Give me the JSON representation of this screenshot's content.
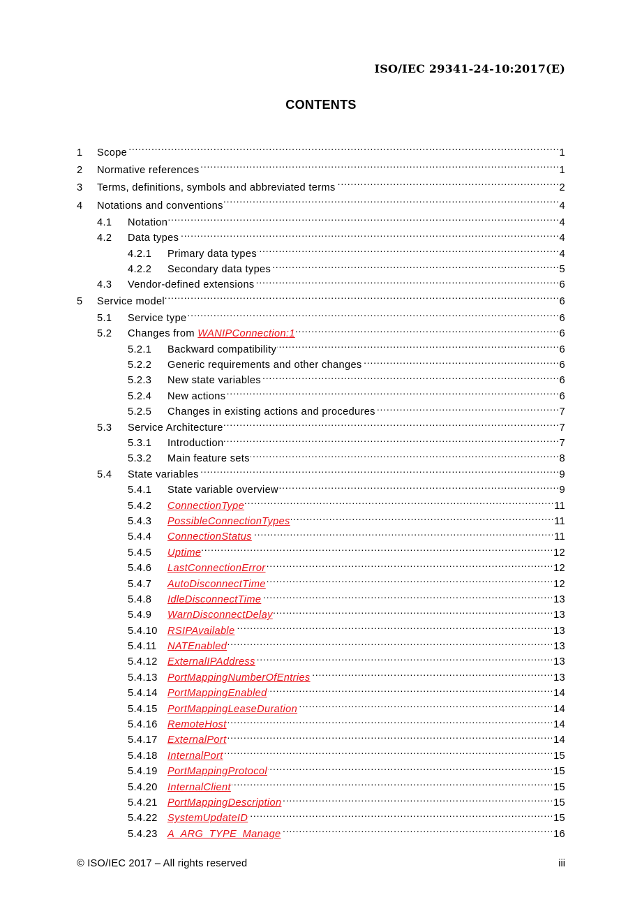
{
  "header": {
    "document_id": "ISO/IEC 29341-24-10:2017(E)"
  },
  "contents_title": "CONTENTS",
  "toc": [
    {
      "level": 1,
      "number": "1",
      "title": "Scope",
      "link": false,
      "page": "1"
    },
    {
      "level": 1,
      "number": "2",
      "title": "Normative references",
      "link": false,
      "page": "1"
    },
    {
      "level": 1,
      "number": "3",
      "title": "Terms, definitions, symbols and abbreviated terms",
      "link": false,
      "page": "2"
    },
    {
      "level": 1,
      "number": "4",
      "title": "Notations and conventions",
      "link": false,
      "page": "4"
    },
    {
      "level": 2,
      "number": "4.1",
      "title": "Notation",
      "link": false,
      "page": "4"
    },
    {
      "level": 2,
      "number": "4.2",
      "title": "Data types",
      "link": false,
      "page": "4"
    },
    {
      "level": 3,
      "number": "4.2.1",
      "title": "Primary data types",
      "link": false,
      "page": "4"
    },
    {
      "level": 3,
      "number": "4.2.2",
      "title": "Secondary data types",
      "link": false,
      "page": "5"
    },
    {
      "level": 2,
      "number": "4.3",
      "title": "Vendor-defined extensions",
      "link": false,
      "page": "6"
    },
    {
      "level": 1,
      "number": "5",
      "title": "Service model",
      "link": false,
      "page": "6"
    },
    {
      "level": 2,
      "number": "5.1",
      "title": "Service type",
      "link": false,
      "page": "6"
    },
    {
      "level": 2,
      "number": "5.2",
      "title": "Changes from ",
      "link_text": "WANIPConnection:1",
      "link": true,
      "page": "6"
    },
    {
      "level": 3,
      "number": "5.2.1",
      "title": "Backward compatibility",
      "link": false,
      "page": "6"
    },
    {
      "level": 3,
      "number": "5.2.2",
      "title": "Generic requirements and other changes",
      "link": false,
      "page": "6"
    },
    {
      "level": 3,
      "number": "5.2.3",
      "title": "New state variables",
      "link": false,
      "page": "6"
    },
    {
      "level": 3,
      "number": "5.2.4",
      "title": "New actions",
      "link": false,
      "page": "6"
    },
    {
      "level": 3,
      "number": "5.2.5",
      "title": "Changes in existing actions and procedures",
      "link": false,
      "page": "7"
    },
    {
      "level": 2,
      "number": "5.3",
      "title": "Service Architecture",
      "link": false,
      "page": "7"
    },
    {
      "level": 3,
      "number": "5.3.1",
      "title": "Introduction",
      "link": false,
      "page": "7"
    },
    {
      "level": 3,
      "number": "5.3.2",
      "title": "Main feature sets",
      "link": false,
      "page": "8"
    },
    {
      "level": 2,
      "number": "5.4",
      "title": "State variables",
      "link": false,
      "page": "9"
    },
    {
      "level": 3,
      "number": "5.4.1",
      "title": "State variable overview",
      "link": false,
      "page": "9"
    },
    {
      "level": 3,
      "number": "5.4.2",
      "title": "",
      "link_text": "ConnectionType",
      "link": true,
      "page": "11"
    },
    {
      "level": 3,
      "number": "5.4.3",
      "title": "",
      "link_text": "PossibleConnectionTypes",
      "link": true,
      "page": "11"
    },
    {
      "level": 3,
      "number": "5.4.4",
      "title": "",
      "link_text": "ConnectionStatus",
      "link": true,
      "page": "11"
    },
    {
      "level": 3,
      "number": "5.4.5",
      "title": "",
      "link_text": "Uptime",
      "link": true,
      "page": "12"
    },
    {
      "level": 3,
      "number": "5.4.6",
      "title": "",
      "link_text": "LastConnectionError",
      "link": true,
      "page": "12"
    },
    {
      "level": 3,
      "number": "5.4.7",
      "title": "",
      "link_text": "AutoDisconnectTime",
      "link": true,
      "page": "12"
    },
    {
      "level": 3,
      "number": "5.4.8",
      "title": "",
      "link_text": "IdleDisconnectTime",
      "link": true,
      "page": "13"
    },
    {
      "level": 3,
      "number": "5.4.9",
      "title": "",
      "link_text": "WarnDisconnectDelay",
      "link": true,
      "page": "13"
    },
    {
      "level": 3,
      "number": "5.4.10",
      "title": "",
      "link_text": "RSIPAvailable",
      "link": true,
      "page": "13"
    },
    {
      "level": 3,
      "number": "5.4.11",
      "title": "",
      "link_text": "NATEnabled",
      "link": true,
      "page": "13"
    },
    {
      "level": 3,
      "number": "5.4.12",
      "title": "",
      "link_text": "ExternalIPAddress",
      "link": true,
      "page": "13"
    },
    {
      "level": 3,
      "number": "5.4.13",
      "title": "",
      "link_text": "PortMappingNumberOfEntries",
      "link": true,
      "page": "13"
    },
    {
      "level": 3,
      "number": "5.4.14",
      "title": "",
      "link_text": "PortMappingEnabled",
      "link": true,
      "page": "14"
    },
    {
      "level": 3,
      "number": "5.4.15",
      "title": "",
      "link_text": "PortMappingLeaseDuration",
      "link": true,
      "page": "14"
    },
    {
      "level": 3,
      "number": "5.4.16",
      "title": "",
      "link_text": "RemoteHost",
      "link": true,
      "page": "14"
    },
    {
      "level": 3,
      "number": "5.4.17",
      "title": "",
      "link_text": "ExternalPort",
      "link": true,
      "page": "14"
    },
    {
      "level": 3,
      "number": "5.4.18",
      "title": "",
      "link_text": "InternalPort",
      "link": true,
      "page": "15"
    },
    {
      "level": 3,
      "number": "5.4.19",
      "title": "",
      "link_text": "PortMappingProtocol",
      "link": true,
      "page": "15"
    },
    {
      "level": 3,
      "number": "5.4.20",
      "title": "",
      "link_text": "InternalClient",
      "link": true,
      "page": "15"
    },
    {
      "level": 3,
      "number": "5.4.21",
      "title": "",
      "link_text": "PortMappingDescription",
      "link": true,
      "page": "15"
    },
    {
      "level": 3,
      "number": "5.4.22",
      "title": "",
      "link_text": "SystemUpdateID",
      "link": true,
      "page": "15"
    },
    {
      "level": 3,
      "number": "5.4.23",
      "title": "",
      "link_text": "A_ARG_TYPE_Manage",
      "link": true,
      "page": "16"
    }
  ],
  "footer": {
    "copyright": "© ISO/IEC 2017 – All rights reserved",
    "page_number": "iii"
  },
  "colors": {
    "link": "#e8141c",
    "text": "#000000"
  }
}
